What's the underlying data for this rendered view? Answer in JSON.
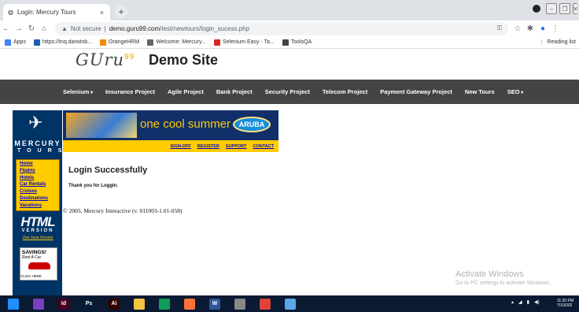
{
  "browser": {
    "tab_title": "Login: Mercury Tours",
    "tab_close": "×",
    "new_tab": "+",
    "not_secure": "Not secure",
    "url_host": "demo.guru99.com",
    "url_path": "/test/newtours/login_sucess.php",
    "bookmarks": [
      {
        "label": "Apps",
        "icon": "apps-grid-icon",
        "color": "#4285f4"
      },
      {
        "label": "https://tnq.darwinb...",
        "icon": "darwinbox-icon",
        "color": "#1a5fb4"
      },
      {
        "label": "OrangeHRM",
        "icon": "orangehrm-icon",
        "color": "#f28c00"
      },
      {
        "label": "Welcome: Mercury...",
        "icon": "globe-icon",
        "color": "#666666"
      },
      {
        "label": "Selenium Easy - Ta...",
        "icon": "selenium-easy-icon",
        "color": "#d62828"
      },
      {
        "label": "ToolsQA",
        "icon": "toolsqa-icon",
        "color": "#444444"
      }
    ],
    "reading_list": "Reading list"
  },
  "site": {
    "logo_text": "GUru",
    "logo_sup": "99",
    "title": "Demo Site",
    "nav": [
      "Selenium",
      "Insurance Project",
      "Agile Project",
      "Bank Project",
      "Security Project",
      "Telecom Project",
      "Payment Gateway Project",
      "New Tours",
      "SEO"
    ]
  },
  "mercury": {
    "brand_word1": "MERCURY",
    "brand_word2": "TOURS",
    "banner_text": "one cool summer",
    "banner_badge": "ARUBA",
    "top_links": [
      "SIGN-OFF",
      "REGISTER",
      "SUPPORT",
      "CONTACT"
    ],
    "side_menu": [
      "Home",
      "Flights",
      "Hotels",
      "Car Rentals",
      "Cruises",
      "Destinations",
      "Vacations"
    ],
    "html_word": "HTML",
    "version_word": "VERSION",
    "java_link": "Use Java Version",
    "savings_title": "SAVINGS!",
    "savings_sub": "Rent A Car",
    "click_here": "CLICK HERE",
    "heading": "Login Successfully",
    "thanks": "Thank you for Loggin.",
    "copyright": "© 2005, Mercury Interactive (v. 011003-1.01-058)"
  },
  "windows": {
    "activate_title": "Activate Windows",
    "activate_sub": "Go to PC settings to activate Windows.",
    "clock_time": "11:20 PM",
    "clock_date": "7/10/202",
    "taskbar_apps": [
      {
        "name": "windows-start-icon",
        "label": "",
        "color": "#1e90ff"
      },
      {
        "name": "visual-studio-icon",
        "label": "",
        "color": "#7b3fbf"
      },
      {
        "name": "indesign-icon",
        "label": "Id",
        "color": "#49021f"
      },
      {
        "name": "photoshop-icon",
        "label": "Ps",
        "color": "#001e36"
      },
      {
        "name": "illustrator-icon",
        "label": "Ai",
        "color": "#330000"
      },
      {
        "name": "file-explorer-icon",
        "label": "",
        "color": "#f5c542"
      },
      {
        "name": "edge-icon",
        "label": "",
        "color": "#0f9d58"
      },
      {
        "name": "firefox-icon",
        "label": "",
        "color": "#ff7139"
      },
      {
        "name": "word-icon",
        "label": "W",
        "color": "#2b579a"
      },
      {
        "name": "settings-icon",
        "label": "",
        "color": "#888888"
      },
      {
        "name": "chrome-icon",
        "label": "",
        "color": "#db4437"
      },
      {
        "name": "paint-icon",
        "label": "",
        "color": "#5aa9e6"
      }
    ]
  }
}
